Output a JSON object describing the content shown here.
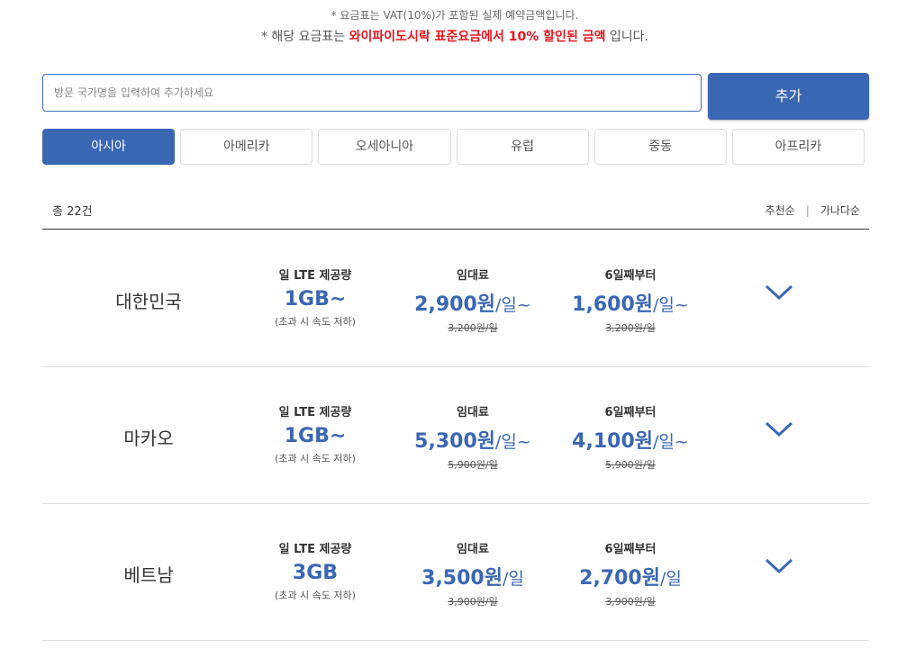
{
  "notice": {
    "line1": "* 요금표는 VAT(10%)가 포함된 실제 예약금액입니다.",
    "line2_prefix": "* 해당 요금표는 ",
    "line2_highlight": "와이파이도시락 표준요금에서 10% 할인된 금액",
    "line2_suffix": " 입니다."
  },
  "search": {
    "placeholder": "방문 국가명을 입력하여 추가하세요",
    "add_label": "추가"
  },
  "tabs": [
    "아시아",
    "아메리카",
    "오세아니아",
    "유럽",
    "중동",
    "아프리카"
  ],
  "active_tab": "아시아",
  "list_header": {
    "count": "총 22건",
    "sort_recommended": "추천순",
    "sort_separator": "|",
    "sort_alpha": "가나다순"
  },
  "column_labels": {
    "data": "일 LTE 제공량",
    "rental": "임대료",
    "from_day6": "6일째부터"
  },
  "rows": [
    {
      "country": "대한민국",
      "data": "1GB~",
      "data_note": "(초과 시 속도 저하)",
      "rental_price": "2,900원",
      "rental_unit": "/일~",
      "rental_old": "3,200원/일",
      "day6_price": "1,600원",
      "day6_unit": "/일~",
      "day6_old": "3,200원/일"
    },
    {
      "country": "마카오",
      "data": "1GB~",
      "data_note": "(초과 시 속도 저하)",
      "rental_price": "5,300원",
      "rental_unit": "/일~",
      "rental_old": "5,900원/일",
      "day6_price": "4,100원",
      "day6_unit": "/일~",
      "day6_old": "5,900원/일"
    },
    {
      "country": "베트남",
      "data": "3GB",
      "data_note": "(초과 시 속도 저하)",
      "rental_price": "3,500원",
      "rental_unit": "/일",
      "rental_old": "3,900원/일",
      "day6_price": "2,700원",
      "day6_unit": "/일",
      "day6_old": "3,900원/일"
    }
  ],
  "colors": {
    "accent": "#3a67b3",
    "highlight": "#e8141d"
  }
}
